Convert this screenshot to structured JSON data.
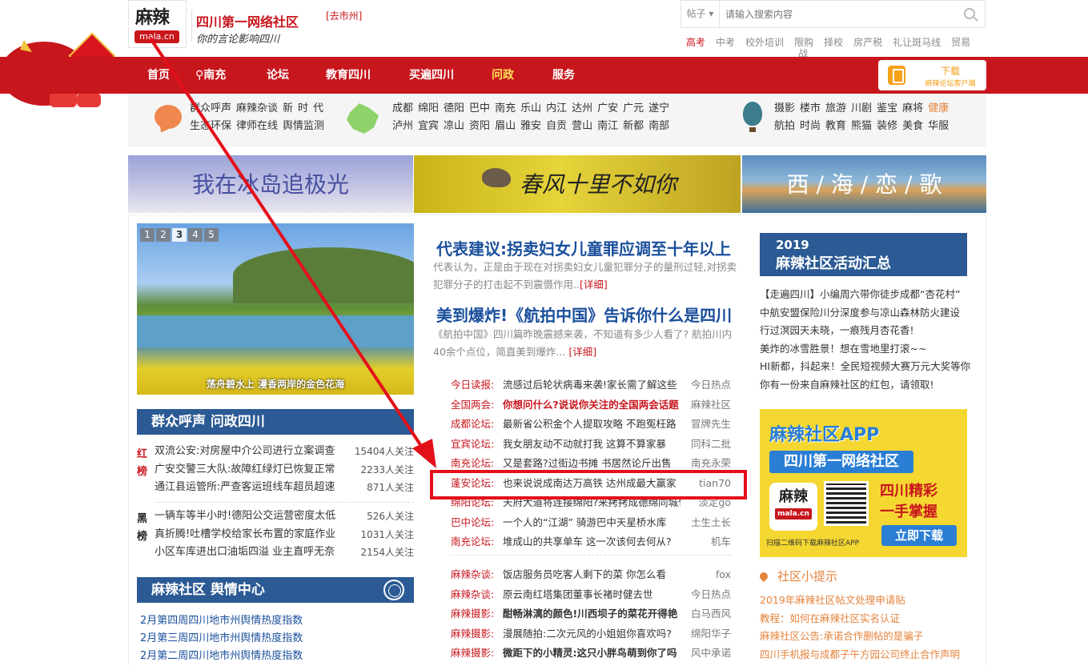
{
  "header": {
    "logo_text": "麻辣",
    "logo_domain": "mala.cn",
    "site_name": "四川第一网络社区",
    "slogan": "你的言论影响四川",
    "city_link": "[去市州]",
    "search": {
      "scope": "帖子",
      "placeholder": "请输入搜索内容"
    },
    "hot_links": [
      "高考",
      "中考",
      "校外培训",
      "限购",
      "择校",
      "房产税",
      "礼让斑马线",
      "贸易"
    ],
    "hot_links_overflow": "战"
  },
  "nav": {
    "items": [
      "首页",
      "南充",
      "论坛",
      "教育四川",
      "买遍四川",
      "问政",
      "服务"
    ],
    "active": "问政",
    "download_title": "下载",
    "download_sub": "麻辣论坛客户端"
  },
  "categories": {
    "group1": [
      [
        "群众呼声",
        "麻辣杂谈",
        "新",
        "时",
        "代"
      ],
      [
        "生态环保",
        "律师在线",
        "舆情监测"
      ]
    ],
    "group2": [
      [
        "成都",
        "绵阳",
        "德阳",
        "巴中",
        "南充",
        "乐山",
        "内江",
        "达州",
        "广安",
        "广元",
        "遂宁"
      ],
      [
        "泸州",
        "宜宾",
        "凉山",
        "资阳",
        "眉山",
        "雅安",
        "自贡",
        "营山",
        "南江",
        "新都",
        "南部"
      ]
    ],
    "group3": [
      [
        "摄影",
        "楼市",
        "旅游",
        "川剧",
        "鉴宝",
        "麻将",
        "健康"
      ],
      [
        "航拍",
        "时尚",
        "教育",
        "熊猫",
        "装修",
        "美食",
        "华服"
      ]
    ]
  },
  "banners": [
    "我在冰岛追极光",
    "春风十里不如你",
    "西 / 海 / 恋 / 歌"
  ],
  "slider": {
    "pages": [
      "1",
      "2",
      "3",
      "4",
      "5"
    ],
    "active_page": "3",
    "caption": "荡舟碧水上 漫香两岸的金色花海"
  },
  "left": {
    "section1_title": "群众呼声 问政四川",
    "red_tag": "红榜",
    "red_list": [
      {
        "title": "双流公安:对房屋中介公司进行立案调查",
        "count": "15404人关注"
      },
      {
        "title": "广安交警三大队:故障红绿灯已恢复正常",
        "count": "2233人关注"
      },
      {
        "title": "通江县运管所:严查客运班线车超员超速",
        "count": "871人关注"
      }
    ],
    "black_tag": "黑榜",
    "black_list": [
      {
        "title": "一辆车等半小时!德阳公交运营密度太低",
        "count": "526人关注"
      },
      {
        "title": "真折腾!吐槽学校给家长布置的家庭作业",
        "count": "1031人关注"
      },
      {
        "title": "小区车库进出口油垢四溢 业主直呼无奈",
        "count": "2154人关注"
      }
    ],
    "section2_title": "麻辣社区 舆情中心",
    "yuqing": [
      "2月第四周四川地市州舆情热度指数",
      "2月第三周四川地市州舆情热度指数",
      "2月第二周四川地市州舆情热度指数"
    ]
  },
  "middle": {
    "headline1": "代表建议:拐卖妇女儿童罪应调至十年以上",
    "summary1": "代表认为，正是由于现在对拐卖妇女儿童犯罪分子的量刑过轻,对拐卖犯罪分子的打击起不到震慑作用..",
    "headline2": "美到爆炸!《航拍中国》告诉你什么是四川",
    "summary2": "《航拍中国》四川篇昨晚震撼来袭，不知道有多少人看了? 航拍川内40余个点位，简直美到爆炸...",
    "more": "[详细]",
    "forum_list1": [
      {
        "cat": "今日读报:",
        "title": "流感过后轮状病毒来袭!家长需了解这些",
        "author": "今日热点",
        "style": ""
      },
      {
        "cat": "全国两会:",
        "title": "你想问什么?说说你关注的全国两会话题",
        "author": "麻辣社区",
        "style": "red"
      },
      {
        "cat": "成都论坛:",
        "title": "最新省公积金个人提取攻略 不跑冤枉路",
        "author": "冒牌先生",
        "style": ""
      },
      {
        "cat": "宜宾论坛:",
        "title": "我女朋友动不动就打我 这算不算家暴",
        "author": "同科二批",
        "style": ""
      },
      {
        "cat": "南充论坛:",
        "title": "又是套路?过街边书摊 书居然论斤出售",
        "author": "南充永荣",
        "style": ""
      },
      {
        "cat": "蓬安论坛:",
        "title": "也来说说成南达万高铁 达州成最大赢家",
        "author": "tian70",
        "style": ""
      },
      {
        "cat": "绵阳论坛:",
        "title": "天府大道将连接绵阳?来拷拷成德绵同城化",
        "author": "淡定go",
        "style": ""
      },
      {
        "cat": "巴中论坛:",
        "title": "一个人的“江湖” 骑游巴中天星桥水库",
        "author": "土生土长",
        "style": ""
      },
      {
        "cat": "南充论坛:",
        "title": "堆成山的共享单车 这一次该何去何从?",
        "author": "机车",
        "style": ""
      }
    ],
    "forum_list2": [
      {
        "cat": "麻辣杂谈:",
        "title": "饭店服务员吃客人剩下的菜 你怎么看",
        "author": "fox",
        "style": ""
      },
      {
        "cat": "麻辣杂谈:",
        "title": "原云南红塔集团董事长褚时健去世",
        "author": "今日热点",
        "style": ""
      },
      {
        "cat": "麻辣摄影:",
        "title": "酣畅淋漓的颜色!川西坝子的菜花开得艳",
        "author": "白马西风",
        "style": "bold"
      },
      {
        "cat": "麻辣摄影:",
        "title": "漫展随拍:二次元风的小姐姐你喜欢吗?",
        "author": "绵阳华子",
        "style": ""
      },
      {
        "cat": "麻辣摄影:",
        "title": "微距下的小精灵:这只小胖鸟萌到你了吗",
        "author": "风中承诺",
        "style": "bold"
      }
    ]
  },
  "right": {
    "activity_year": "2019",
    "activity_title": "麻辣社区活动汇总",
    "news": [
      "【走遍四川】小编周六带你徒步成都“杏花村”",
      "中航安盟保险川分深度参与凉山森林防火建设",
      "行过溟园天未晓，一痕残月杏花香!",
      "美炸的冰雪胜景！想在雪地里打滚~~",
      "HI新都，抖起来！全民短视频大赛万元大奖等你",
      "你有一份来自麻辣社区的红包，请领取!"
    ],
    "app_ad": {
      "title": "麻辣社区APP",
      "sub": "四川第一网络社区",
      "slogan1": "四川精彩",
      "slogan2": "一手掌握",
      "button": "立即下载",
      "caption": "扫描二维码下载麻辣社区APP",
      "icon_text": "麻辣",
      "icon_domain": "mala.cn"
    },
    "tips_title": "社区小提示",
    "tips": [
      "2019年麻辣社区帖文处理申请贴",
      "教程：如何在麻辣社区实名认证",
      "麻辣社区公告:承诺合作删帖的是骗子",
      "四川手机报与成都子午方园公司终止合作声明"
    ]
  },
  "annotation": {
    "highlight_color": "#e3101a"
  }
}
